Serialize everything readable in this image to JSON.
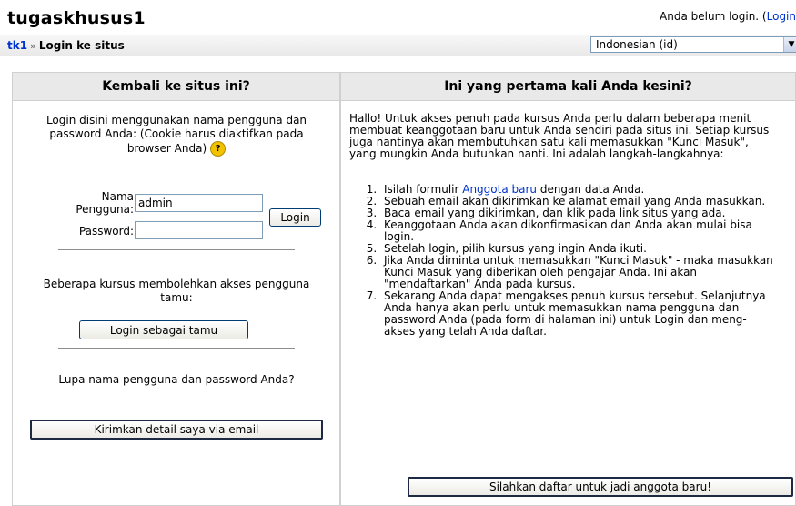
{
  "header": {
    "site_title": "tugaskhusus1",
    "login_status": "Anda belum login. (",
    "login_link": "Login"
  },
  "navbar": {
    "breadcrumb_home": "tk1",
    "breadcrumb_sep": "»",
    "breadcrumb_current": "Login ke situs",
    "language_value": "Indonesian (id)"
  },
  "left": {
    "heading": "Kembali ke situs ini?",
    "intro": "Login disini menggunakan nama pengguna dan password Anda: (Cookie harus diaktifkan pada browser Anda)",
    "username_label_1": "Nama",
    "username_label_2": "Pengguna:",
    "username_value": "admin",
    "password_label": "Password:",
    "login_button": "Login",
    "guest_text": "Beberapa kursus membolehkan akses pengguna tamu:",
    "guest_button": "Login sebagai tamu",
    "forgot_text": "Lupa nama pengguna dan password Anda?",
    "forgot_button": "Kirimkan detail saya via email"
  },
  "right": {
    "heading": "Ini yang pertama kali Anda kesini?",
    "intro": "Hallo! Untuk akses penuh pada kursus Anda perlu dalam beberapa menit membuat keanggotaan baru untuk Anda sendiri pada situs ini. Setiap kursus juga nantinya akan membutuhkan satu kali memasukkan \"Kunci Masuk\", yang mungkin Anda butuhkan nanti. Ini adalah langkah-langkahnya:",
    "step1_before": "Isilah formulir ",
    "step1_link": "Anggota baru",
    "step1_after": " dengan data Anda.",
    "step2": "Sebuah email akan dikirimkan ke alamat email yang Anda masukkan.",
    "step3": "Baca email yang dikirimkan, dan klik pada link situs yang ada.",
    "step4": "Keanggotaan Anda akan dikonfirmasikan dan Anda akan mulai bisa login.",
    "step5": "Setelah login, pilih kursus yang ingin Anda ikuti.",
    "step6": "Jika Anda diminta untuk memasukkan \"Kunci Masuk\" - maka masukkan Kunci Masuk yang diberikan oleh pengajar Anda. Ini akan \"mendaftarkan\" Anda pada kursus.",
    "step7": "Sekarang Anda dapat mengakses penuh kursus tersebut. Selanjutnya Anda hanya akan perlu untuk memasukkan nama pengguna dan password Anda (pada form di halaman ini) untuk Login dan meng-akses yang telah Anda daftar.",
    "signup_button": "Silahkan daftar untuk jadi anggota baru!"
  },
  "icons": {
    "help": "help-icon",
    "dropdown": "chevron-down-icon"
  }
}
